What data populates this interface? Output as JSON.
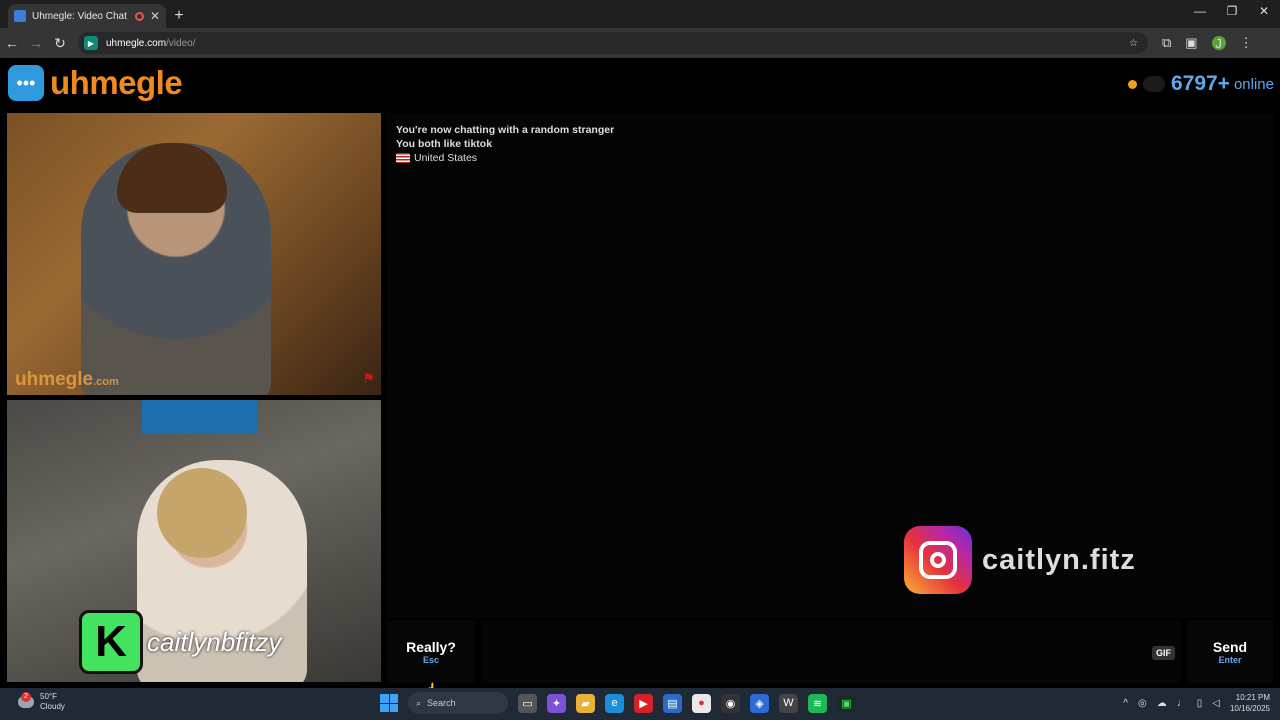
{
  "browser": {
    "tab_title": "Uhmegle: Video Chat | Omegle Alternative",
    "url_host": "uhmegle.com",
    "url_path": "/video/",
    "new_tab_symbol": "+",
    "profile_initial": "J"
  },
  "site": {
    "logo_text": "uhmegle",
    "online_count": "6797+",
    "online_label": "online"
  },
  "video": {
    "watermark": "uhmegle",
    "watermark_suffix": ".com",
    "kick_letter": "K",
    "kick_handle": "caitlynbfitzy"
  },
  "chat": {
    "messages": [
      "You're now chatting with a random stranger",
      "You both like tiktok"
    ],
    "country": "United States"
  },
  "overlays": {
    "instagram_handle": "caitlyn.fitz",
    "tiktok_handle": "caitlynbfitzy"
  },
  "controls": {
    "skip_label": "Really?",
    "skip_hint": "Esc",
    "gif_label": "GIF",
    "send_label": "Send",
    "send_hint": "Enter"
  },
  "taskbar": {
    "notification_count": "2",
    "temperature": "50°F",
    "weather": "Cloudy",
    "search_placeholder": "Search",
    "time": "10:21 PM",
    "date": "10/16/2025"
  },
  "colors": {
    "brand_orange": "#f08a1f",
    "accent_blue": "#5fa8ea",
    "kick_green": "#42e35f"
  }
}
